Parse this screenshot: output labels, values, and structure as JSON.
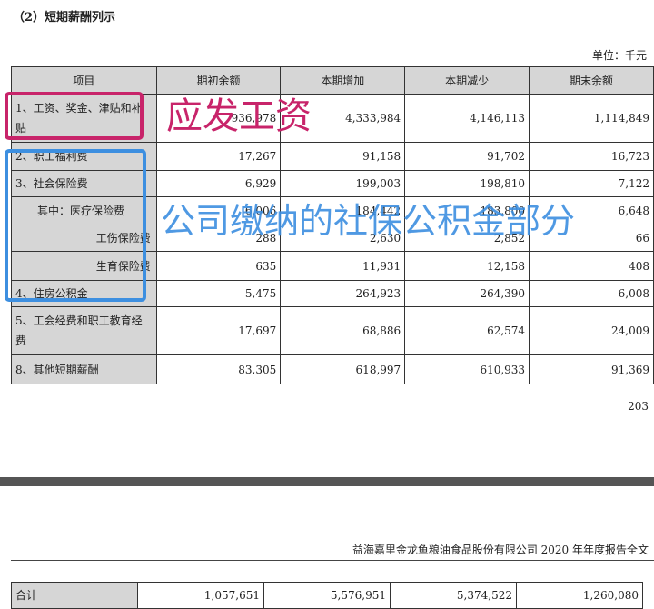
{
  "title": "（2）短期薪酬列示",
  "unit": "单位：千元",
  "headers": [
    "项目",
    "期初余额",
    "本期增加",
    "本期减少",
    "期末余额"
  ],
  "rows": [
    {
      "item": "1、工资、奖金、津贴和补贴",
      "open": "936,978",
      "inc": "4,333,984",
      "dec": "4,146,113",
      "close": "1,114,849"
    },
    {
      "item": "2、职工福利费",
      "open": "17,267",
      "inc": "91,158",
      "dec": "91,702",
      "close": "16,723"
    },
    {
      "item": "3、社会保险费",
      "open": "6,929",
      "inc": "199,003",
      "dec": "198,810",
      "close": "7,122"
    },
    {
      "item": "其中：医疗保险费",
      "open": "6,006",
      "inc": "184,442",
      "dec": "183,800",
      "close": "6,648"
    },
    {
      "item": "工伤保险费",
      "open": "288",
      "inc": "2,630",
      "dec": "2,852",
      "close": "66"
    },
    {
      "item": "生育保险费",
      "open": "635",
      "inc": "11,931",
      "dec": "12,158",
      "close": "408"
    },
    {
      "item": "4、住房公积金",
      "open": "5,475",
      "inc": "264,923",
      "dec": "264,390",
      "close": "6,008"
    },
    {
      "item": "5、工会经费和职工教育经费",
      "open": "17,697",
      "inc": "68,886",
      "dec": "62,574",
      "close": "24,009"
    },
    {
      "item": "8、其他短期薪酬",
      "open": "83,305",
      "inc": "618,997",
      "dec": "610,933",
      "close": "91,369"
    }
  ],
  "page_number": "203",
  "footer": "益海嘉里金龙鱼粮油食品股份有限公司 2020 年年度报告全文",
  "total": {
    "item": "合计",
    "open": "1,057,651",
    "inc": "5,576,951",
    "dec": "5,374,522",
    "close": "1,260,080"
  },
  "annotations": {
    "gross_pay": "应发工资",
    "company_contrib": "公司缴纳的社保公积金部分"
  },
  "colors": {
    "pink": "#c8246a",
    "blue": "#3d8fe0"
  }
}
